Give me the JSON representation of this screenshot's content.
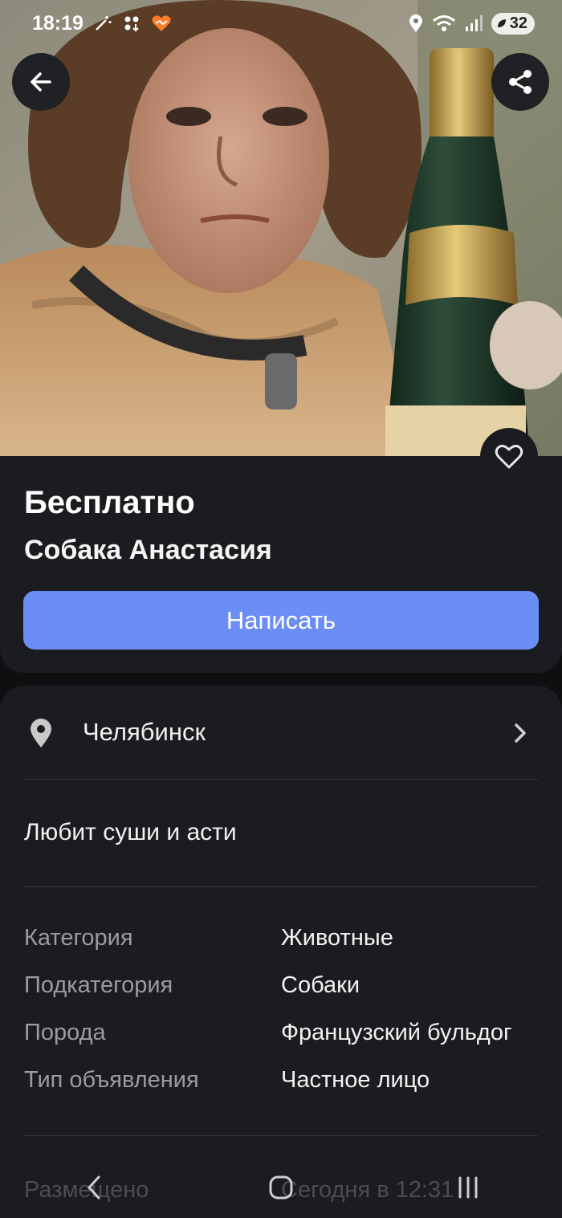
{
  "status_bar": {
    "time": "18:19",
    "battery": "32"
  },
  "listing": {
    "price": "Бесплатно",
    "title": "Собака Анастасия",
    "contact_button": "Написать"
  },
  "details": {
    "city": "Челябинск",
    "description": "Любит суши и асти",
    "properties": [
      {
        "key": "Категория",
        "value": "Животные"
      },
      {
        "key": "Подкатегория",
        "value": "Собаки"
      },
      {
        "key": "Порода",
        "value": "Французский бульдог"
      },
      {
        "key": "Тип объявления",
        "value": "Частное лицо"
      }
    ],
    "posted_label": "Размещено",
    "posted_value": "Сегодня в 12:31"
  },
  "colors": {
    "accent_button": "#6b8ef6",
    "card_background": "#1b1c1f",
    "page_background": "#0e0f11"
  },
  "icons": [
    "back-arrow-icon",
    "share-icon",
    "heart-icon",
    "location-pin-icon",
    "chevron-right-icon",
    "nav-back-icon",
    "nav-home-icon",
    "nav-recents-icon"
  ]
}
